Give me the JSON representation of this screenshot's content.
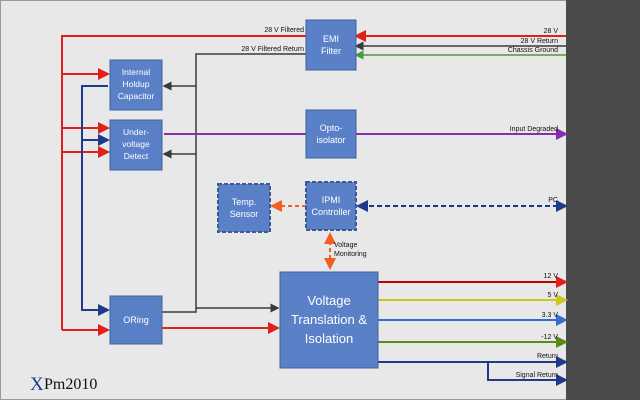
{
  "boxes": {
    "emi_filter": [
      "EMI",
      "Filter"
    ],
    "holdup": [
      "Internal",
      "Holdup",
      "Capacitor"
    ],
    "undervoltage": [
      "Under-",
      "voltage",
      "Detect"
    ],
    "opto": [
      "Opto-",
      "isolator"
    ],
    "temp_sensor": [
      "Temp.",
      "Sensor"
    ],
    "ipmi": [
      "IPMI",
      "Controller"
    ],
    "oring": [
      "ORing"
    ],
    "vti": [
      "Voltage",
      "Translation &",
      "Isolation"
    ]
  },
  "signals": {
    "filtered_28v": "28 V Filtered",
    "filtered_return": "28 V Filtered Return",
    "in_28v": "28 V",
    "return_28v": "28 V Return",
    "chassis_ground": "Chassis Ground",
    "input_degraded": "Input Degraded",
    "pc": "PC",
    "voltage_monitoring": [
      "Voltage",
      "Monitoring"
    ],
    "out_12v": "12 V",
    "out_5v": "5 V",
    "out_3v3": "3.3 V",
    "out_neg12v": "-12 V",
    "return": "Return",
    "signal_return": "Signal Return"
  },
  "logo": {
    "x": "X",
    "rest": "Pm2010"
  },
  "colors": {
    "red": "#e0201c",
    "navy": "#1f3a8a",
    "gray": "#3a3a3a",
    "green": "#4a9a3a",
    "purple": "#8a2bb0",
    "yellow": "#c8c820",
    "blue": "#2f6fd0",
    "olive": "#5a8a1a",
    "orange": "#f06020",
    "box": "#5a80c8",
    "box_border": "#3f5f9f",
    "backplane": "#4a4a4a"
  }
}
